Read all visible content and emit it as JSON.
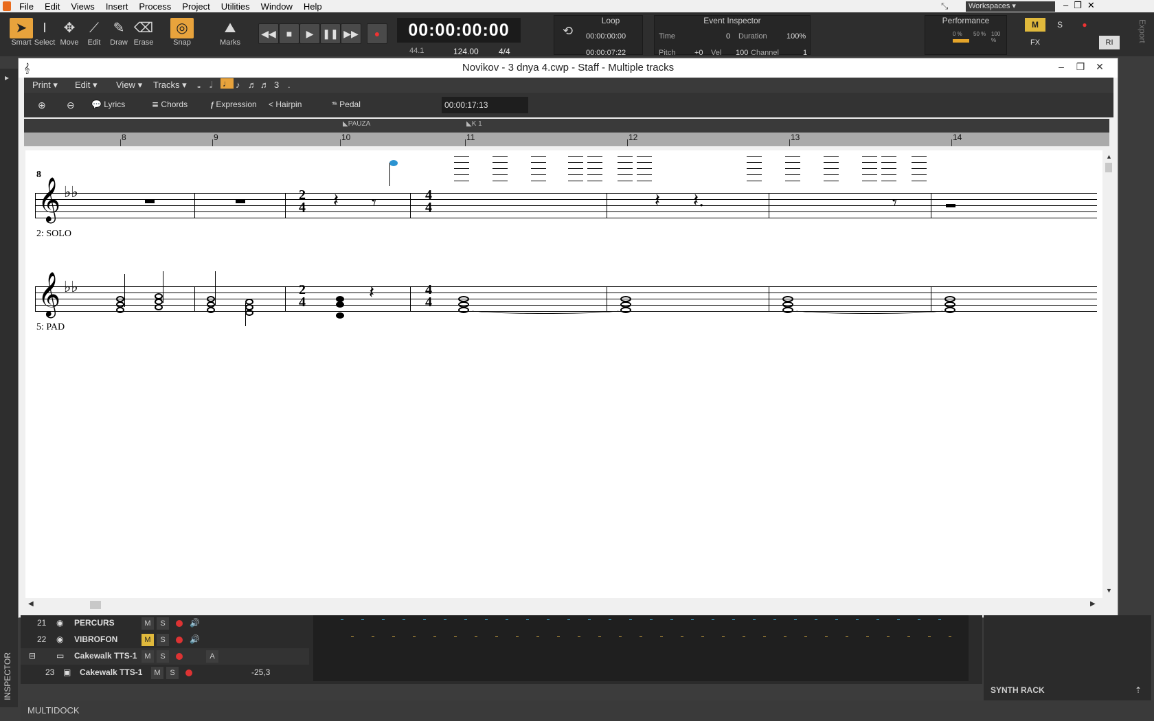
{
  "menu": [
    "File",
    "Edit",
    "Views",
    "Insert",
    "Process",
    "Project",
    "Utilities",
    "Window",
    "Help"
  ],
  "tools": [
    {
      "label": "Smart",
      "icon": "pointer-icon",
      "active": true
    },
    {
      "label": "Select",
      "icon": "text-cursor-icon",
      "active": false
    },
    {
      "label": "Move",
      "icon": "move-icon",
      "active": false
    },
    {
      "label": "Edit",
      "icon": "edit-icon",
      "active": false
    },
    {
      "label": "Draw",
      "icon": "pencil-icon",
      "active": false
    },
    {
      "label": "Erase",
      "icon": "eraser-icon",
      "active": false
    }
  ],
  "snap": {
    "label": "Snap",
    "marks_label": "Marks"
  },
  "transport": {
    "time": "00:00:00:00",
    "tempo": "124.00",
    "meter": "4/4",
    "sample_rate": "44.1"
  },
  "loop": {
    "title": "Loop",
    "start": "00:00:00:00",
    "end": "00:00:07:22"
  },
  "event_inspector": {
    "title": "Event Inspector",
    "time_label": "Time",
    "time_value": "0",
    "duration_label": "Duration",
    "duration_value": "100%",
    "pitch_label": "Pitch",
    "pitch_value": "+0",
    "vel_label": "Vel",
    "vel_value": "100",
    "channel_label": "Channel",
    "channel_value": "1"
  },
  "performance": {
    "title": "Performance",
    "cpu": "0 %",
    "disk": "50 %",
    "mem": "100 %"
  },
  "workspaces": "Workspaces",
  "window": {
    "title": "Novikov  -  3  dnya   4.cwp - Staff - Multiple tracks"
  },
  "staff_toolbar": {
    "print": "Print",
    "edit": "Edit",
    "view": "View",
    "tracks": "Tracks",
    "triplet": "3",
    "dot": "."
  },
  "staff_tools": {
    "lyrics": "Lyrics",
    "chords": "Chords",
    "expression": "Expression",
    "hairpin": "Hairpin",
    "pedal": "Pedal",
    "time": "00:00:17:13"
  },
  "ruler": {
    "markers": [
      "PAUZA",
      "K 1"
    ],
    "measures": [
      "8",
      "9",
      "10",
      "11",
      "12",
      "13",
      "14"
    ]
  },
  "score": {
    "measure_number": "8",
    "staves": [
      {
        "label": "2: SOLO"
      },
      {
        "label": "5: PAD"
      }
    ],
    "time_sig_1": [
      "2",
      "4"
    ],
    "time_sig_2": [
      "4",
      "4"
    ]
  },
  "tracks": [
    {
      "num": "21",
      "name": "PERCURS",
      "mute": false
    },
    {
      "num": "22",
      "name": "VIBROFON",
      "mute": true
    },
    {
      "num": "",
      "name": "Cakewalk TTS-1",
      "mute": false,
      "folder": true
    },
    {
      "num": "23",
      "name": "Cakewalk TTS-1",
      "mute": false,
      "value": "-25,3"
    }
  ],
  "synth_rack": "SYNTH RACK",
  "multidock": "MULTIDOCK",
  "inspector": "INSPECTOR",
  "export": "Export"
}
